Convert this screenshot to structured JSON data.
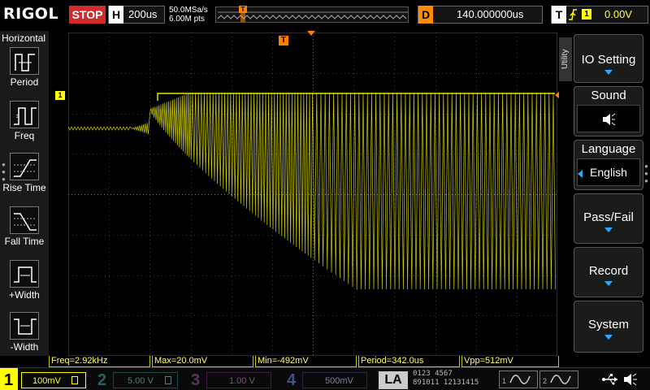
{
  "brand": "RIGOL",
  "run_state": "STOP",
  "horizontal": {
    "letter": "H",
    "timebase": "200us",
    "sample_rate": "50.0MSa/s",
    "memory_depth": "6.00M pts"
  },
  "delay": {
    "letter": "D",
    "value": "140.000000us"
  },
  "trigger": {
    "letter": "T",
    "edge_icon": "rising-edge-icon",
    "source": "1",
    "level": "0.00V"
  },
  "trigger_marker": "T",
  "left_menu": {
    "title": "Horizontal",
    "items": [
      {
        "label": "Period",
        "icon": "period-icon"
      },
      {
        "label": "Freq",
        "icon": "freq-icon"
      },
      {
        "label": "Rise Time",
        "icon": "rise-time-icon"
      },
      {
        "label": "Fall Time",
        "icon": "fall-time-icon"
      },
      {
        "label": "+Width",
        "icon": "pos-width-icon"
      },
      {
        "label": "-Width",
        "icon": "neg-width-icon"
      }
    ]
  },
  "right_menu": {
    "tab": "Utility",
    "io_setting": "IO Setting",
    "sound": "Sound",
    "language": "Language",
    "language_value": "English",
    "pass_fail": "Pass/Fail",
    "record": "Record",
    "system": "System"
  },
  "ch1_marker": "1",
  "measurements": [
    {
      "label": "Freq=2.92kHz"
    },
    {
      "label": "Max=20.0mV"
    },
    {
      "label": "Min=-492mV"
    },
    {
      "label": "Period=342.0us"
    },
    {
      "label": "Vpp=512mV"
    }
  ],
  "channels": [
    {
      "num": "1",
      "scale": "100mV",
      "color": "#ffff00"
    },
    {
      "num": "2",
      "scale": "5.00 V",
      "color": "#00c8c8"
    },
    {
      "num": "3",
      "scale": "1.00 V",
      "color": "#d000d0"
    },
    {
      "num": "4",
      "scale": "500mV",
      "color": "#2a7fff"
    }
  ],
  "la_label": "LA",
  "la_digits": {
    "row1": "0123 4567",
    "row2": "891011 12131415"
  },
  "generators": [
    "1",
    "2"
  ],
  "trace_color": "#e6e600"
}
